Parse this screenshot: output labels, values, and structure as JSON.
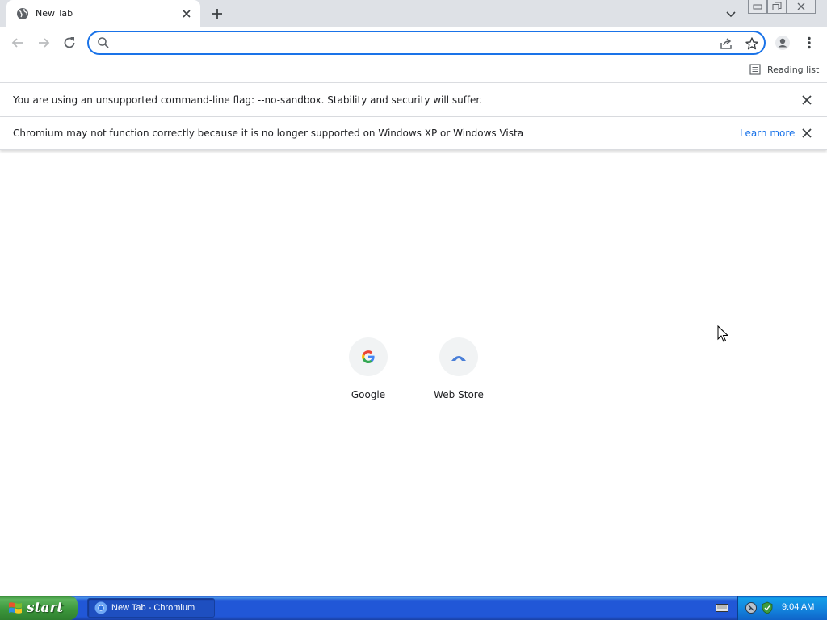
{
  "browser": {
    "tab": {
      "title": "New Tab",
      "favicon": "globe-icon"
    },
    "omnibox": {
      "value": "",
      "placeholder": ""
    },
    "bookmarks_bar": {
      "reading_list_label": "Reading list"
    }
  },
  "infobars": [
    {
      "text": "You are using an unsupported command-line flag: --no-sandbox. Stability and security will suffer."
    },
    {
      "text": "Chromium may not function correctly because it is no longer supported on Windows XP or Windows Vista",
      "link": "Learn more"
    }
  ],
  "new_tab_page": {
    "shortcuts": [
      {
        "label": "Google",
        "icon": "google-g-icon"
      },
      {
        "label": "Web Store",
        "icon": "web-store-icon"
      }
    ]
  },
  "taskbar": {
    "start_label": "start",
    "task_label": "New Tab - Chromium",
    "clock": "9:04 AM"
  },
  "colors": {
    "accent": "#1a73e8",
    "tabstrip": "#dee1e6",
    "taskbar_blue": "#2157d7",
    "start_green": "#3a953a"
  }
}
